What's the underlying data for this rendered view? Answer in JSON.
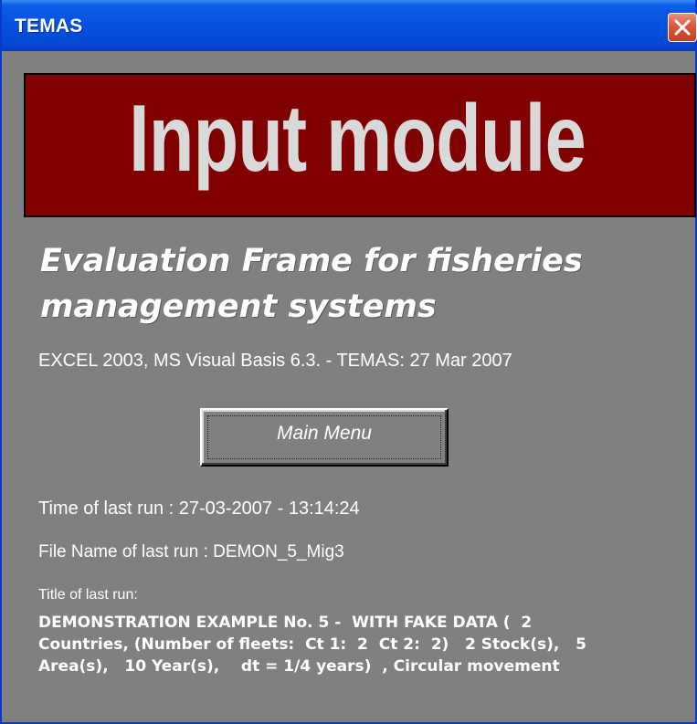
{
  "window": {
    "title": "TEMAS"
  },
  "banner": {
    "text": "Input module"
  },
  "subtitle": {
    "line1": "Evaluation Frame for fisheries",
    "line2": "management systems"
  },
  "version_text": "EXCEL 2003, MS Visual Basis 6.3. - TEMAS: 27 Mar 2007",
  "main_menu_button": {
    "label": "Main Menu"
  },
  "last_run": {
    "time": "Time of last run : 27-03-2007 - 13:14:24",
    "file": "File Name of last run : DEMON_5_Mig3",
    "title_label": "Title of last run:",
    "title_lines": [
      "DEMONSTRATION EXAMPLE No. 5 -  WITH FAKE DATA (  2",
      "Countries, (Number of fleets:  Ct 1:  2  Ct 2:  2)   2 Stock(s),   5",
      "Area(s),   10 Year(s),    dt = 1/4 years)  , Circular movement"
    ]
  },
  "colors": {
    "client_background": "#808080",
    "banner_background": "#800000",
    "banner_text": "#d9d9d9",
    "titlebar_blue": "#0551e0",
    "close_button_red": "#d9573a"
  },
  "icons": {
    "close": "close-icon"
  }
}
